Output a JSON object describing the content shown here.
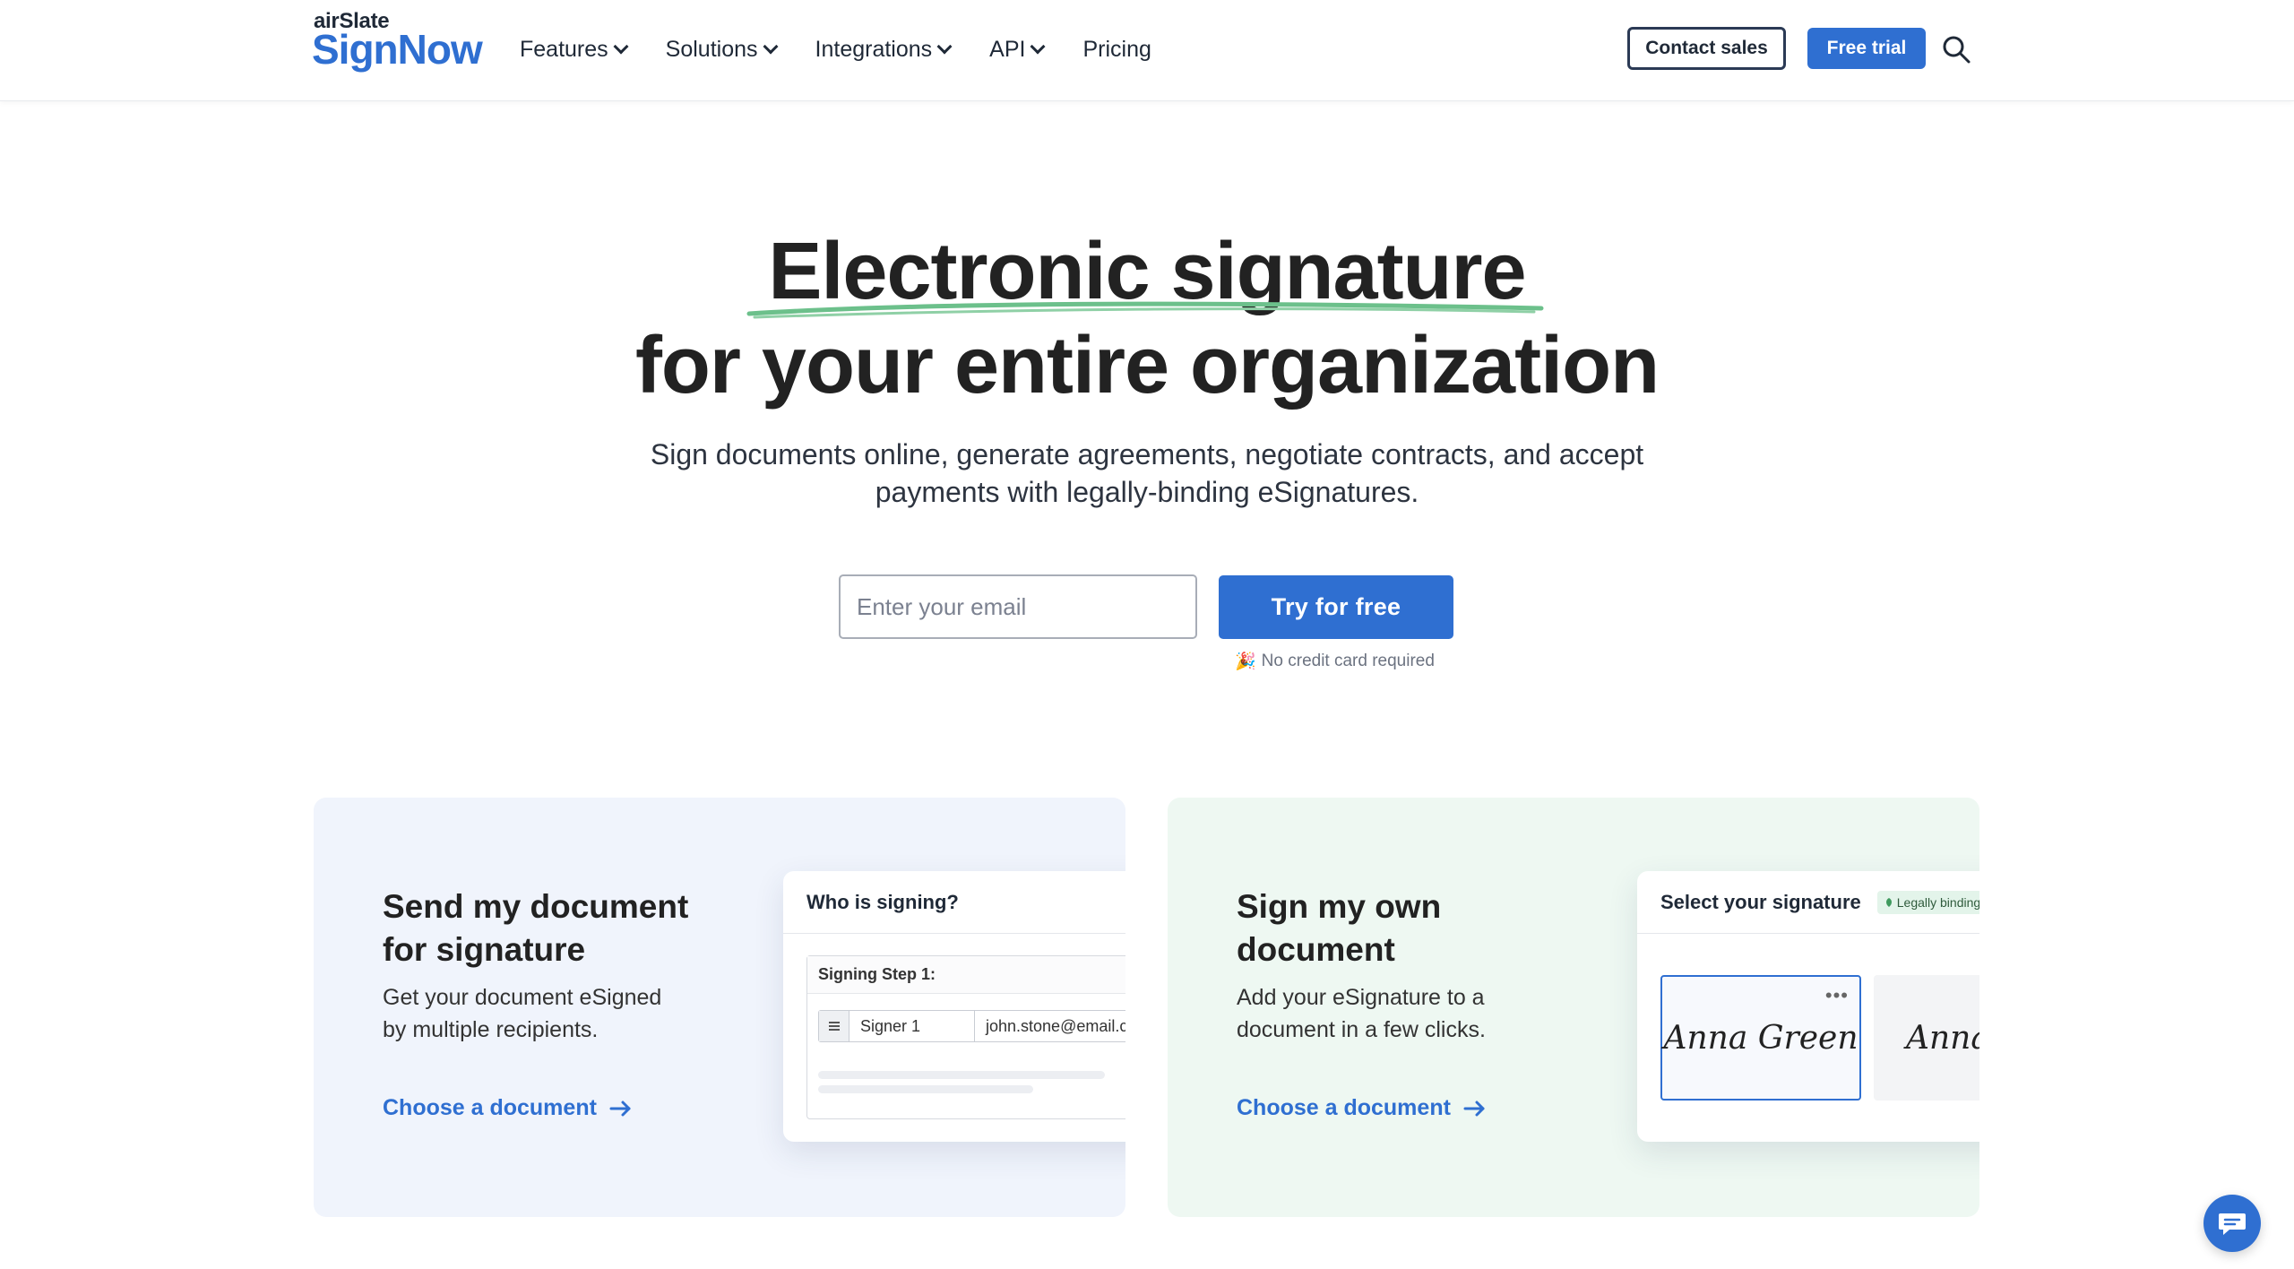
{
  "header": {
    "logo_small": "airSlate",
    "logo_big": "SignNow",
    "nav": [
      {
        "label": "Features",
        "has_dropdown": true
      },
      {
        "label": "Solutions",
        "has_dropdown": true
      },
      {
        "label": "Integrations",
        "has_dropdown": true
      },
      {
        "label": "API",
        "has_dropdown": true
      },
      {
        "label": "Pricing",
        "has_dropdown": false
      }
    ],
    "contact_label": "Contact sales",
    "trial_label": "Free trial",
    "search_icon": "search-icon"
  },
  "hero": {
    "title_line1": "Electronic signature",
    "title_line2": "for your entire organization",
    "subtitle": "Sign documents online, generate agreements, negotiate contracts, and accept payments with legally-binding eSignatures.",
    "email_placeholder": "Enter your email",
    "cta_label": "Try for free",
    "no_cc_icon": "🎉",
    "no_cc_text": "No credit card required"
  },
  "cards": {
    "send": {
      "title": "Send my document for signature",
      "desc": "Get your document eSigned by multiple recipients.",
      "link": "Choose a document",
      "panel_title": "Who is signing?",
      "step_title": "Signing Step 1:",
      "signer_name": "Signer 1",
      "signer_email": "john.stone@email.com"
    },
    "sign": {
      "title": "Sign my own document",
      "desc": "Add your eSignature to a document in a few clicks.",
      "link": "Choose a document",
      "panel_title": "Select your signature",
      "badge": "Legally binding",
      "signature1": "Anna Green",
      "signature2": "Anna G"
    }
  },
  "colors": {
    "accent": "#2f6fd1",
    "underline": "#6cc08b",
    "card_left_bg": "#f0f4fc",
    "card_right_bg": "#eef8f2"
  }
}
